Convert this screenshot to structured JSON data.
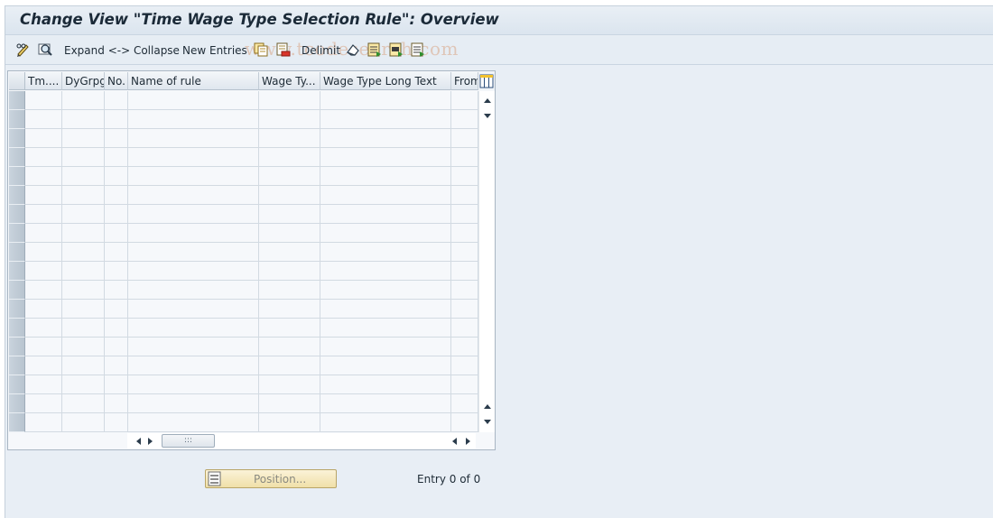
{
  "window": {
    "title": "Change View \"Time Wage Type Selection Rule\": Overview"
  },
  "toolbar": {
    "display_change_icon": "pencil-glasses-icon",
    "find_icon": "find-icon",
    "expand_collapse_label": "Expand <-> Collapse",
    "new_entries_label": "New Entries",
    "copy_icon": "copy-icon",
    "delete_icon": "delete-icon",
    "delimit_label": "Delimit",
    "undo_icon": "undo-change-icon",
    "select_all_icon": "select-all-icon",
    "select_block_icon": "select-block-icon",
    "deselect_all_icon": "deselect-all-icon",
    "watermark": "www.tcodesearch.com"
  },
  "table": {
    "columns": [
      {
        "label": "Tm...."
      },
      {
        "label": "DyGrpg"
      },
      {
        "label": "No."
      },
      {
        "label": "Name of rule"
      },
      {
        "label": "Wage Ty..."
      },
      {
        "label": "Wage Type Long Text"
      },
      {
        "label": "From"
      }
    ],
    "empty_rows": 18,
    "column_settings_icon": "column-settings-icon",
    "hscroll_thumb": ":::"
  },
  "footer": {
    "position_label": "Position...",
    "position_icon": "position-icon",
    "entry_text": "Entry 0 of 0"
  },
  "colors": {
    "background": "#e8eef5",
    "position_button": "#f4e6b5",
    "row_selector": "#bfcad5"
  }
}
